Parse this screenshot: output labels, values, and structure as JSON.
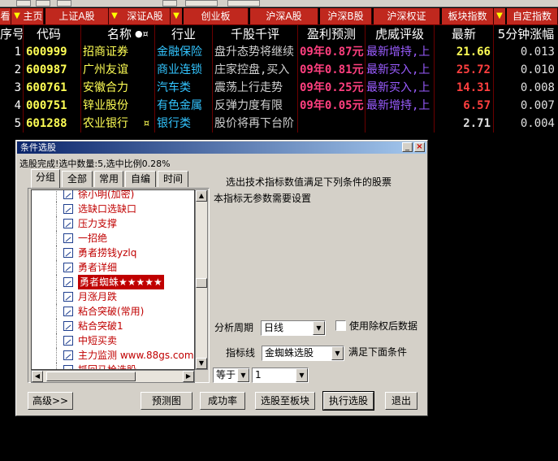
{
  "tab_bar": {
    "cut_label": "看",
    "tabs": [
      "主页",
      "上证A股",
      "深证A股",
      "创业板",
      "沪深A股",
      "沪深B股",
      "沪深权证",
      "板块指数",
      "自定指数"
    ]
  },
  "table": {
    "columns": [
      "序号",
      "代码",
      "名称",
      "行业",
      "千股千评",
      "盈利预测",
      "虎威评级",
      "最新",
      "5分钟涨幅"
    ],
    "name_marks": "●¤",
    "rows": [
      {
        "idx": "1",
        "code": "600999",
        "name": "招商证券",
        "flag": "",
        "industry": "金融保险",
        "comment": "盘升态势将继续",
        "profit": "09年0.87元",
        "tiger": "最新增持,上",
        "price": "21.66",
        "price_color": "#ffff55",
        "change": "0.013"
      },
      {
        "idx": "2",
        "code": "600987",
        "name": "广州友谊",
        "flag": "",
        "industry": "商业连锁",
        "comment": "庄家控盘,买入",
        "profit": "09年0.81元",
        "tiger": "最新买入,上",
        "price": "25.72",
        "price_color": "#ff3f3f",
        "change": "0.010"
      },
      {
        "idx": "3",
        "code": "600761",
        "name": "安徽合力",
        "flag": "",
        "industry": "汽车类",
        "comment": "震荡上行走势",
        "profit": "09年0.25元",
        "tiger": "最新买入,上",
        "price": "14.31",
        "price_color": "#ff3f3f",
        "change": "0.008"
      },
      {
        "idx": "4",
        "code": "000751",
        "name": "锌业股份",
        "flag": "",
        "industry": "有色金属",
        "comment": "反弹力度有限",
        "profit": "09年0.05元",
        "tiger": "最新增持,上",
        "price": "6.57",
        "price_color": "#ff3f3f",
        "change": "0.007"
      },
      {
        "idx": "5",
        "code": "601288",
        "name": "农业银行",
        "flag": "¤",
        "industry": "银行类",
        "comment": "股价将再下台阶",
        "profit": "",
        "tiger": "",
        "price": "2.71",
        "price_color": "#e0e0e0",
        "change": "0.004"
      }
    ]
  },
  "dialog": {
    "title": "条件选股",
    "minimize": "_",
    "close": "×",
    "status": "选股完成!选中数量:5,选中比例0.28%",
    "tabs": [
      "分组",
      "全部",
      "常用",
      "自编",
      "时间"
    ],
    "tree_items": [
      "徐小明(加密)",
      "选缺口选缺口",
      "压力支撑",
      "一招绝",
      "勇者捞钱yzlq",
      "勇者详细",
      "勇者蜘蛛★★★★★",
      "月涨月跌",
      "粘合突破(常用)",
      "粘合突破1",
      "中短买卖",
      "主力监测 www.88gs.com",
      "抓回马枪选股"
    ],
    "right_header": "选出技术指标数值满足下列条件的股票",
    "description": "本指标无参数需要设置",
    "period_label": "分析周期",
    "period_value": "日线",
    "checkbox_label": "使用除权后数据",
    "indicator_label": "指标线",
    "indicator_value": "金蜘蛛选股",
    "satisfy_label": "满足下面条件",
    "operator_value": "等于",
    "operand_value": "1",
    "buttons": {
      "advanced": "高级>>",
      "preview": "预测图",
      "success_rate": "成功率",
      "to_block": "选股至板块",
      "execute": "执行选股",
      "exit": "退出"
    }
  }
}
